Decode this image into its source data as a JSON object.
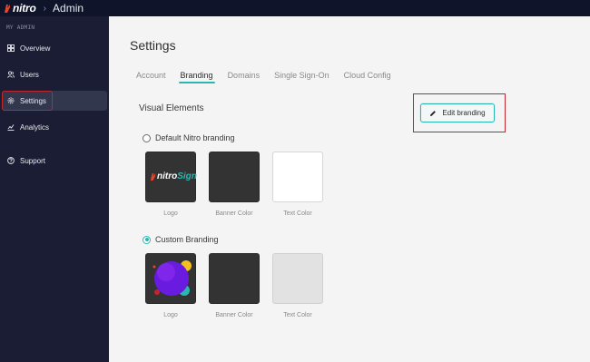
{
  "topbar": {
    "logo_text": "nitro",
    "separator": "›",
    "title": "Admin"
  },
  "sidebar": {
    "section_label": "MY ADMIN",
    "items": [
      {
        "label": "Overview",
        "icon": "grid-icon"
      },
      {
        "label": "Users",
        "icon": "users-icon"
      },
      {
        "label": "Settings",
        "icon": "gear-icon"
      },
      {
        "label": "Analytics",
        "icon": "chart-icon"
      },
      {
        "label": "Support",
        "icon": "help-icon"
      }
    ]
  },
  "main": {
    "title": "Settings",
    "tabs": [
      {
        "label": "Account"
      },
      {
        "label": "Branding"
      },
      {
        "label": "Domains"
      },
      {
        "label": "Single Sign-On"
      },
      {
        "label": "Cloud Config"
      }
    ],
    "active_tab": "Branding",
    "section_title": "Visual Elements",
    "edit_button_label": "Edit branding",
    "default_branding": {
      "label": "Default Nitro branding",
      "selected": false,
      "logo_text_1": "nitro",
      "logo_text_2": "Sign",
      "swatch_labels": [
        "Logo",
        "Banner Color",
        "Text Color"
      ]
    },
    "custom_branding": {
      "label": "Custom Branding",
      "selected": true,
      "swatch_labels": [
        "Logo",
        "Banner Color",
        "Text Color"
      ]
    }
  },
  "colors": {
    "accent": "#2bb7b0",
    "sidebar_bg": "#1a1d33",
    "topbar_bg": "#10142a",
    "highlight_red": "#c0262d",
    "brand_orange": "#e8452c"
  }
}
